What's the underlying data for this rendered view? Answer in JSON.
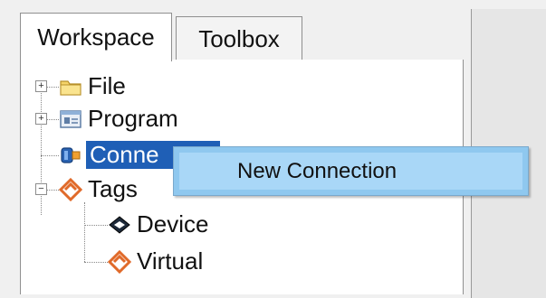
{
  "tabs": {
    "workspace": "Workspace",
    "toolbox": "Toolbox"
  },
  "tree": {
    "file": "File",
    "program": "Program",
    "connection": "Conne",
    "tags": "Tags",
    "device": "Device",
    "virtual": "Virtual"
  },
  "context_menu": {
    "new_connection": "New Connection"
  },
  "colors": {
    "selection": "#1f5fb6",
    "menu_highlight": "#a9d7f7",
    "folder": "#f5d46a",
    "tags_icon": "#e06a2a"
  }
}
